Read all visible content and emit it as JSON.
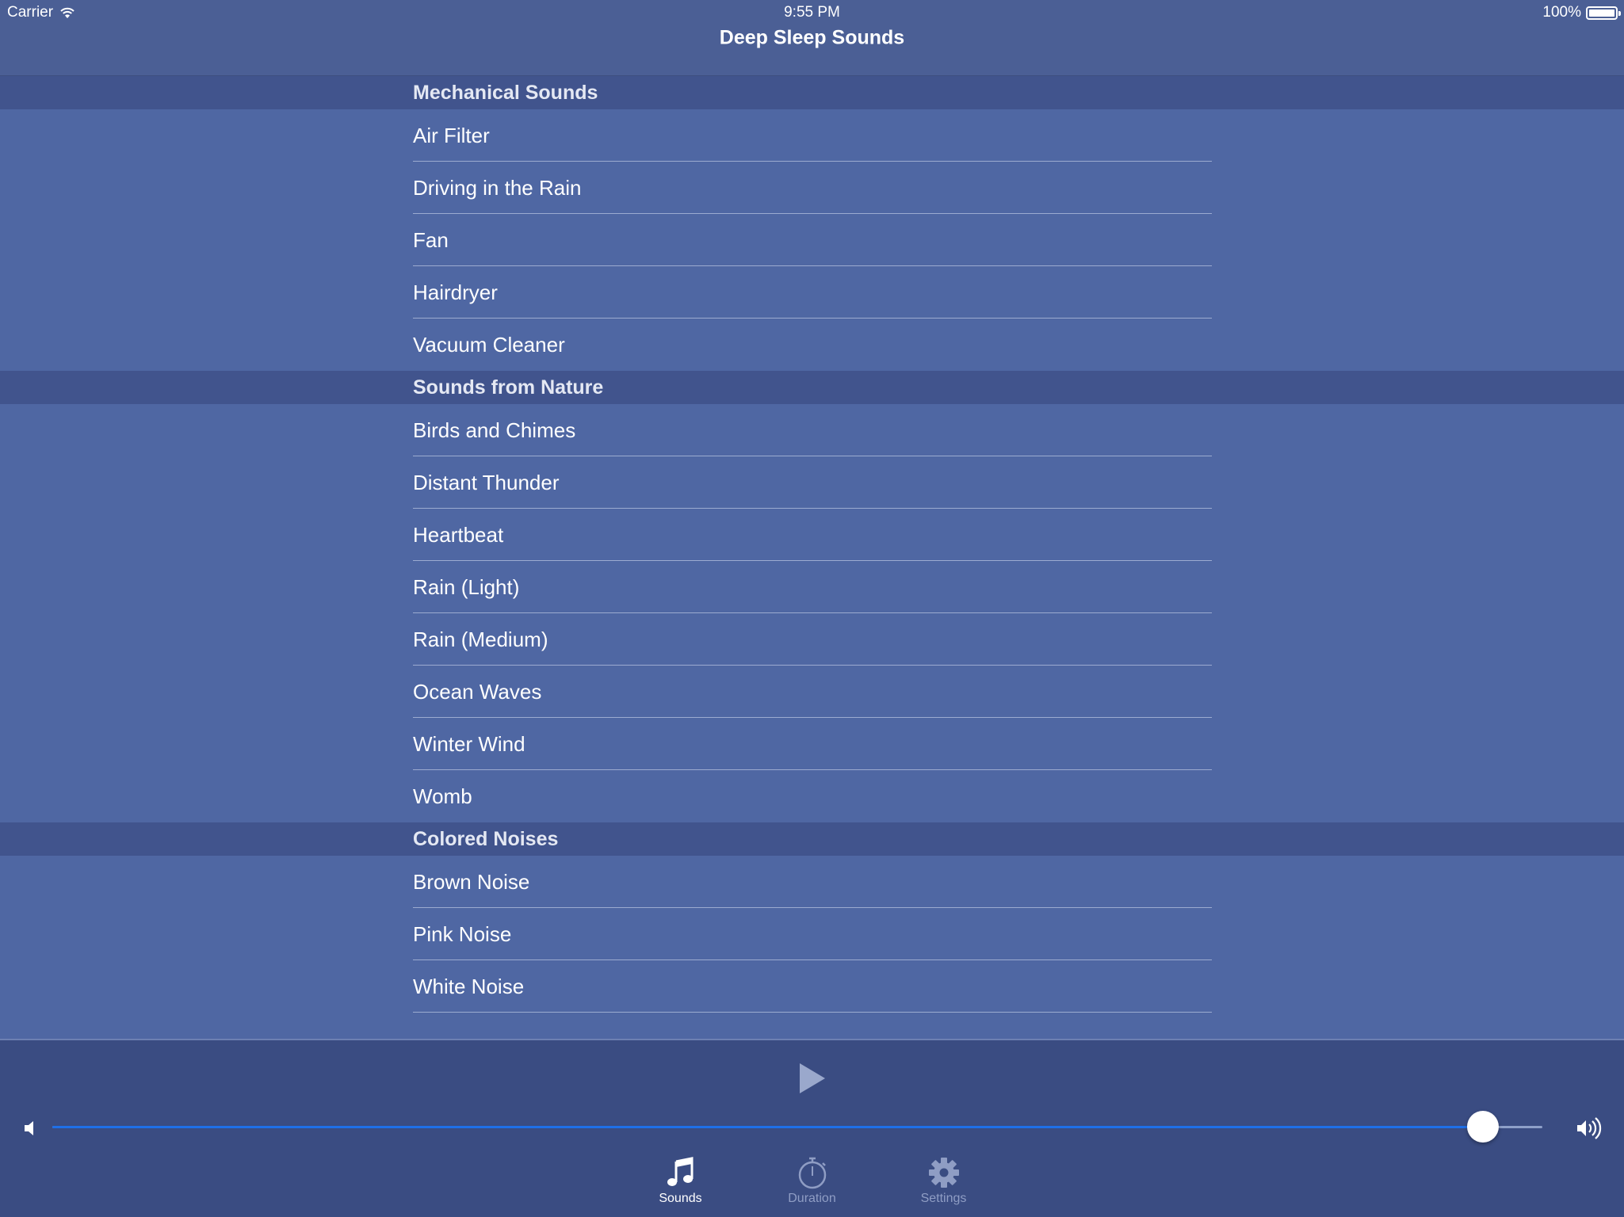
{
  "status_bar": {
    "carrier": "Carrier",
    "time": "9:55 PM",
    "battery": "100%"
  },
  "nav": {
    "title": "Deep Sleep Sounds"
  },
  "sections": [
    {
      "header": "Mechanical Sounds",
      "items": [
        "Air Filter",
        "Driving in the Rain",
        "Fan",
        "Hairdryer",
        "Vacuum Cleaner"
      ]
    },
    {
      "header": "Sounds from Nature",
      "items": [
        "Birds and Chimes",
        "Distant Thunder",
        "Heartbeat",
        "Rain (Light)",
        "Rain (Medium)",
        "Ocean Waves",
        "Winter Wind",
        "Womb"
      ]
    },
    {
      "header": "Colored Noises",
      "items": [
        "Brown Noise",
        "Pink Noise",
        "White Noise"
      ]
    }
  ],
  "player": {
    "volume_fraction": 0.96
  },
  "tabs": [
    {
      "label": "Sounds",
      "icon": "music-note-icon",
      "active": true
    },
    {
      "label": "Duration",
      "icon": "stopwatch-icon",
      "active": false
    },
    {
      "label": "Settings",
      "icon": "gear-icon",
      "active": false
    }
  ],
  "colors": {
    "accent": "#1e6fe8",
    "background": "#4f67a3",
    "section_header": "#41548d",
    "player_bg": "#3a4c82"
  }
}
